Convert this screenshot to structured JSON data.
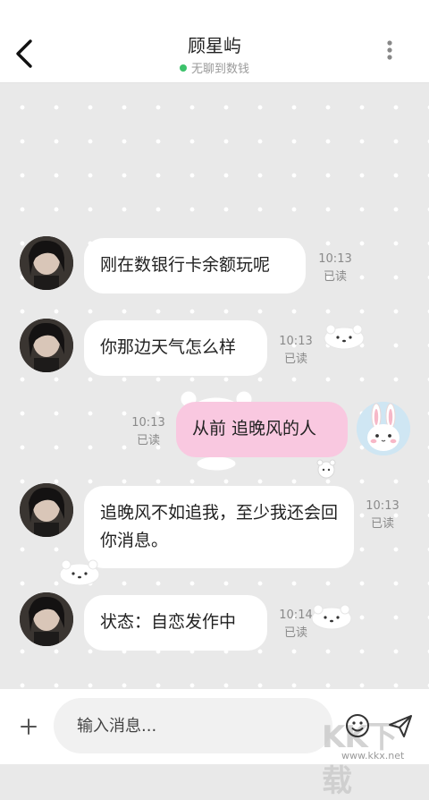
{
  "header": {
    "title": "顾星屿",
    "status": "无聊到数钱",
    "status_color": "#3cc26b"
  },
  "messages": [
    {
      "sender": "other",
      "text": "刚在数银行卡余额玩呢",
      "time": "10:13",
      "read": "已读"
    },
    {
      "sender": "other",
      "text": "你那边天气怎么样",
      "time": "10:13",
      "read": "已读"
    },
    {
      "sender": "me",
      "text": "从前 追晚风的人",
      "time": "10:13",
      "read": "已读"
    },
    {
      "sender": "other",
      "text": "追晚风不如追我，至少我还会回你消息。",
      "time": "10:13",
      "read": "已读"
    },
    {
      "sender": "other",
      "text": "状态：自恋发作中",
      "time": "10:14",
      "read": "已读"
    }
  ],
  "input": {
    "placeholder": "输入消息..."
  },
  "icons": [
    "back-arrow-icon",
    "more-vertical-icon",
    "plus-icon",
    "emoji-icon",
    "send-icon",
    "bunny-avatar",
    "bear-sticker"
  ],
  "colors": {
    "my_bubble": "#f9c8e0",
    "other_bubble": "#ffffff",
    "chat_background": "#e9e9e9"
  },
  "watermark": {
    "logo": "KK下载",
    "url": "www.kkx.net"
  }
}
